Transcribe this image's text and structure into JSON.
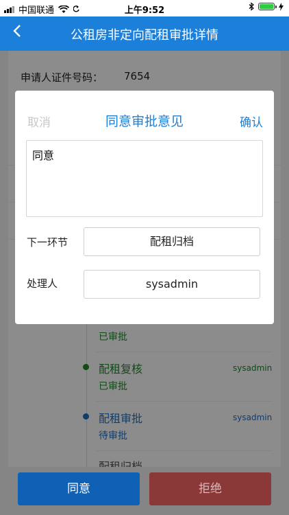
{
  "status_bar": {
    "carrier": "中国联通",
    "time": "上午9:52"
  },
  "nav": {
    "back_icon": "chevron-left-icon",
    "title": "公租房非定向配租审批详情"
  },
  "detail": {
    "id_label": "申请人证件号码：",
    "id_value": "7654"
  },
  "timeline": [
    {
      "title": "",
      "status": "已审批",
      "user": "",
      "color": "#1f8a2a"
    },
    {
      "title": "配租复核",
      "status": "已审批",
      "user": "sysadmin",
      "color": "#1f8a2a"
    },
    {
      "title": "配租审批",
      "status": "待审批",
      "user": "sysadmin",
      "color": "#1c6fc9"
    },
    {
      "title": "配租归档",
      "status": "",
      "user": "",
      "color": "#555555"
    }
  ],
  "dialog": {
    "cancel_label": "取消",
    "title": "同意审批意见",
    "confirm_label": "确认",
    "opinion": "同意",
    "next_step_label": "下一环节",
    "next_step_value": "配租归档",
    "handler_label": "处理人",
    "handler_value": "sysadmin"
  },
  "buttons": {
    "agree": "同意",
    "reject": "拒绝"
  }
}
